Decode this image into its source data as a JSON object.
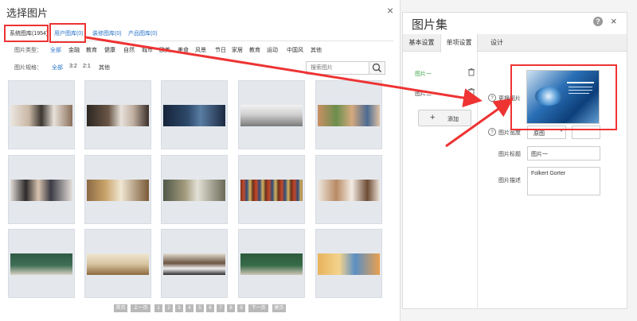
{
  "picker": {
    "title": "选择图片",
    "close": "×",
    "tabs": [
      "系统图库(1954)",
      "用户图库(0)",
      "装修图库(0)",
      "产品图库(0)"
    ],
    "type_label": "图片类型：",
    "type_options": [
      "全部",
      "金融",
      "教育",
      "健康",
      "自然",
      "城市",
      "欧美",
      "美食",
      "风景",
      "节日",
      "家居",
      "教育",
      "运动",
      "中国风",
      "其他"
    ],
    "ratio_label": "图片规格：",
    "ratio_options": [
      "全部",
      "3:2",
      "2:1",
      "其他"
    ],
    "search_placeholder": "搜索图片",
    "pagination": [
      "首页",
      "上一页",
      "1",
      "2",
      "3",
      "4",
      "5",
      "6",
      "7",
      "8",
      "9",
      "下一页",
      "尾页"
    ]
  },
  "panel": {
    "title": "图片集",
    "help": "?",
    "close": "×",
    "tabs": [
      "基本设置",
      "单项设置",
      "设计"
    ],
    "items": [
      "图片一",
      "图片二"
    ],
    "add_label": "添加",
    "change_image_label": "更换图片",
    "size_label": "图片宽度",
    "size_select": "原图",
    "title_label": "图片标题",
    "title_value": "图片一",
    "desc_label": "图片描述",
    "desc_value": "Folkert Gorter"
  },
  "colors": {
    "link": "#2a74c9",
    "active_item": "#3fa64a",
    "annotation": "#e33333"
  }
}
